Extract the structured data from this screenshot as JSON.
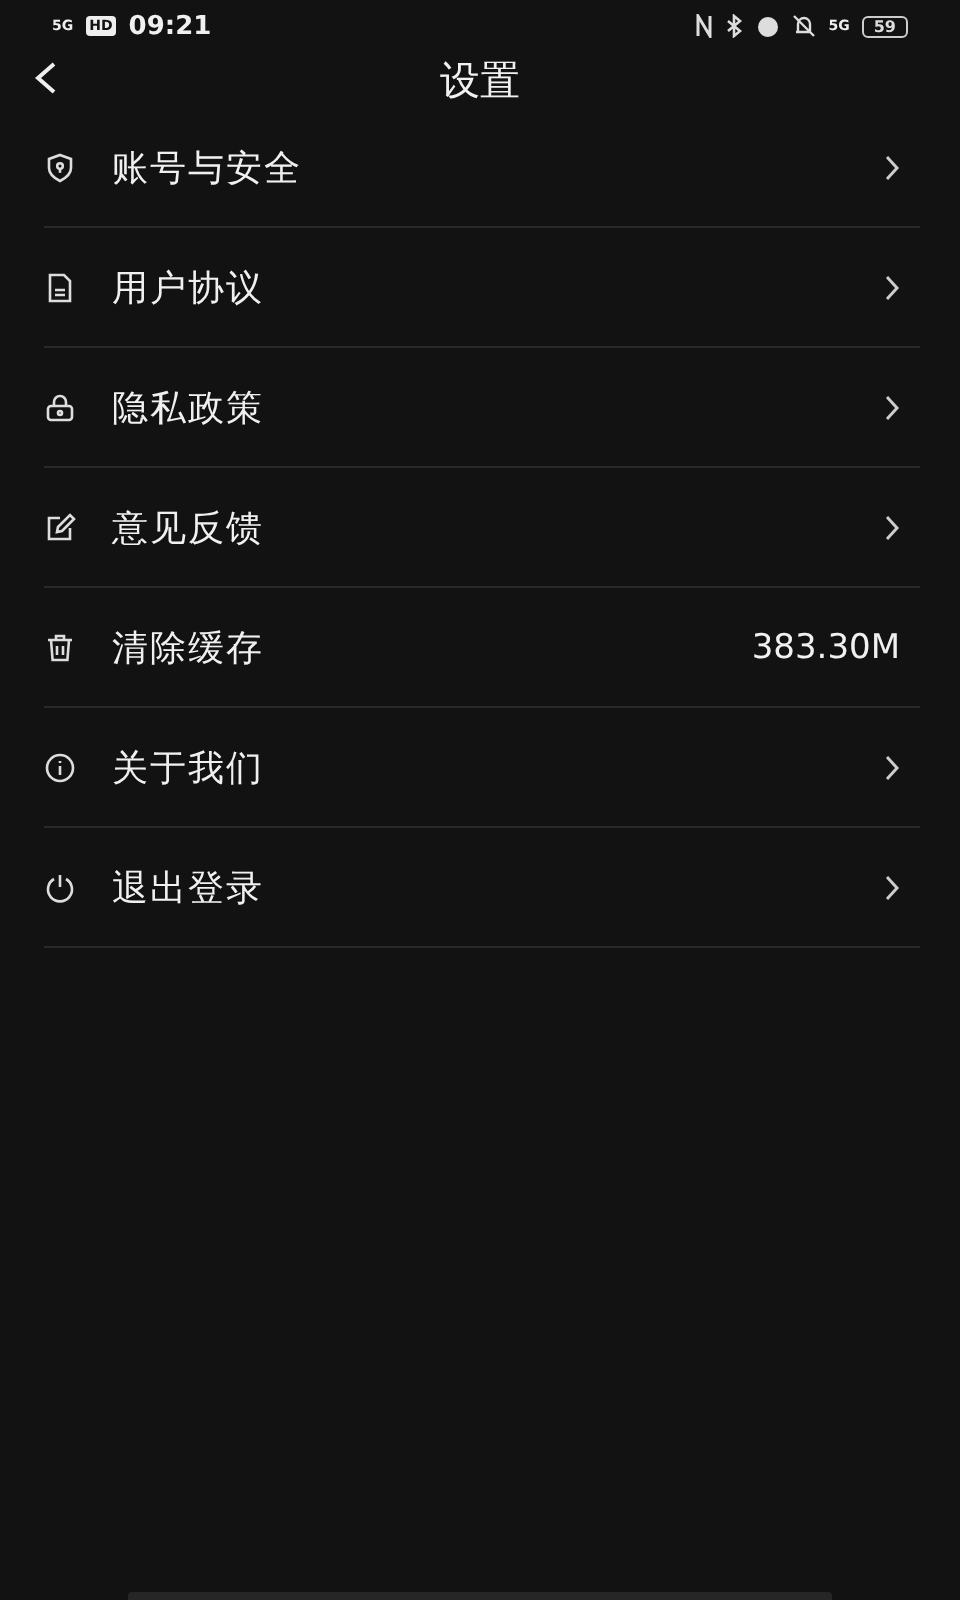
{
  "status_bar": {
    "network": "5G",
    "hd": "HD",
    "time": "09:21",
    "network_right": "5G",
    "battery": "59"
  },
  "header": {
    "title": "设置"
  },
  "items": [
    {
      "label": "账号与安全",
      "kind": "link"
    },
    {
      "label": "用户协议",
      "kind": "link"
    },
    {
      "label": "隐私政策",
      "kind": "link"
    },
    {
      "label": "意见反馈",
      "kind": "link"
    },
    {
      "label": "清除缓存",
      "kind": "value",
      "value": "383.30M"
    },
    {
      "label": "关于我们",
      "kind": "link"
    },
    {
      "label": "退出登录",
      "kind": "link"
    }
  ]
}
